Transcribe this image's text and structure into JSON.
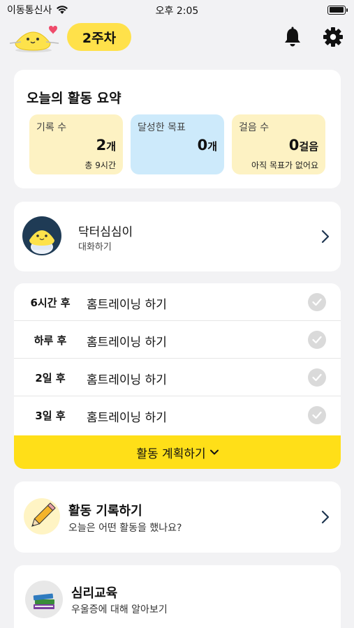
{
  "status_bar": {
    "carrier": "이동통신사",
    "time": "오후 2:05"
  },
  "header": {
    "week_label": "2주차"
  },
  "summary": {
    "title": "오늘의 활동 요약",
    "stats": [
      {
        "label": "기록 수",
        "value": "2",
        "unit": "개",
        "sub": "총 9시간",
        "color": "#fdf2c3"
      },
      {
        "label": "달성한 목표",
        "value": "0",
        "unit": "개",
        "sub": "",
        "color": "#cdeafb"
      },
      {
        "label": "걸음 수",
        "value": "0",
        "unit": "걸음",
        "sub": "아직 목표가 없어요",
        "color": "#fdf2c3"
      }
    ]
  },
  "chat": {
    "name": "닥터심심이",
    "sub": "대화하기"
  },
  "plans": {
    "items": [
      {
        "when": "6시간 후",
        "text": "홈트레이닝 하기"
      },
      {
        "when": "하루 후",
        "text": "홈트레이닝 하기"
      },
      {
        "when": "2일 후",
        "text": "홈트레이닝 하기"
      },
      {
        "when": "3일 후",
        "text": "홈트레이닝 하기"
      }
    ],
    "button_label": "활동 계획하기"
  },
  "record": {
    "title": "활동 기록하기",
    "sub": "오늘은 어떤 활동을 했나요?"
  },
  "education": {
    "title": "심리교육",
    "sub": "우울증에 대해 알아보기"
  },
  "colors": {
    "accent": "#ffdf18",
    "pill": "#ffe14a",
    "background": "#f2f2f4"
  }
}
